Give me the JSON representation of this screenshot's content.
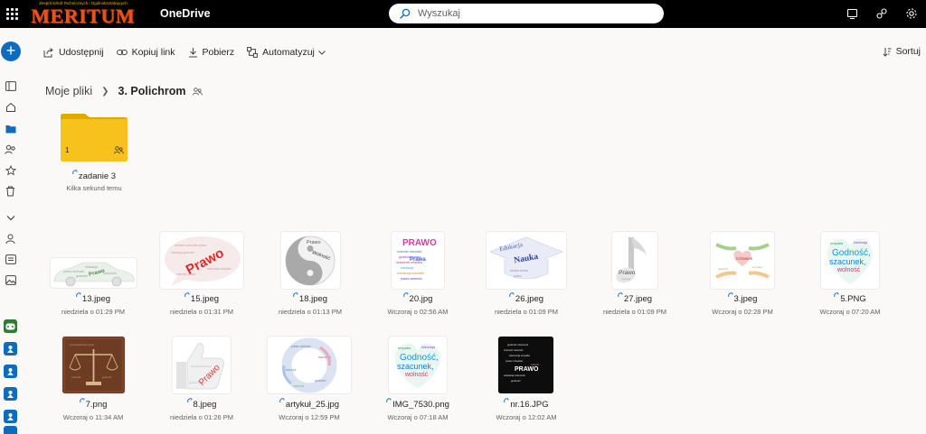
{
  "topbar": {
    "logo_subtitle": "Zespół Szkół Technicznych i Ogólnokształcących",
    "logo_text": "MERITUM",
    "app_name": "OneDrive",
    "search_placeholder": "Wyszukaj"
  },
  "toolbar": {
    "share": "Udostępnij",
    "copy_link": "Kopiuj link",
    "download": "Pobierz",
    "automate": "Automatyzuj",
    "sort": "Sortuj"
  },
  "breadcrumb": {
    "root": "Moje pliki",
    "current": "3. Polichrom"
  },
  "folder": {
    "name": "zadanie 3",
    "count": "1",
    "modified": "Kilka sekund temu",
    "color": "#f8c21c"
  },
  "files_row1": [
    {
      "name": "13.jpeg",
      "date": "niedziela o 01:29 PM"
    },
    {
      "name": "15.jpeg",
      "date": "niedziela o 01:31 PM"
    },
    {
      "name": "18.jpeg",
      "date": "niedziela o 01:13 PM"
    },
    {
      "name": "20.jpg",
      "date": "Wczoraj o 02:56 AM"
    },
    {
      "name": "26.jpeg",
      "date": "niedziela o 01:09 PM"
    },
    {
      "name": "27.jpeg",
      "date": "niedziela o 01:09 PM"
    },
    {
      "name": "3.jpeg",
      "date": "Wczoraj o 02:28 PM"
    },
    {
      "name": "5.PNG",
      "date": "Wczoraj o 07:20 AM"
    }
  ],
  "files_row2": [
    {
      "name": "7.png",
      "date": "Wczoraj o 11:34 AM"
    },
    {
      "name": "8.jpeg",
      "date": "niedziela o 01:26 PM"
    },
    {
      "name": "artykuł_25.jpg",
      "date": "Wczoraj o 12:59 PM"
    },
    {
      "name": "IMG_7530.png",
      "date": "Wczoraj o 07:18 AM"
    },
    {
      "name": "nr.16.JPG",
      "date": "Wczoraj o 12:02 AM"
    }
  ],
  "thumb_words": {
    "prawo": "Prawo",
    "prawo_caps": "PRAWO",
    "wolnosc": "Wolność",
    "nauka": "Nauka",
    "edukacja": "Edukacja",
    "czlowiek": "Człowiek",
    "godnosc": "Godność,",
    "szacunek": "szacunek,",
    "wolnosc_lc": "wolność",
    "empatia": "empatia",
    "tolerancja": "tolerancja"
  },
  "colors": {
    "topbar": "#000000",
    "accent": "#0f6cbd",
    "logo": "#e8521c",
    "folder": "#f8c21c"
  },
  "icons": [
    "waffle-icon",
    "search-icon",
    "monitor-icon",
    "share-settings-icon",
    "gear-icon",
    "share-icon",
    "link-icon",
    "download-icon",
    "automate-icon",
    "chevron-down-icon",
    "sort-icon",
    "chevron-right-icon",
    "shared-people-icon",
    "sync-icon"
  ]
}
